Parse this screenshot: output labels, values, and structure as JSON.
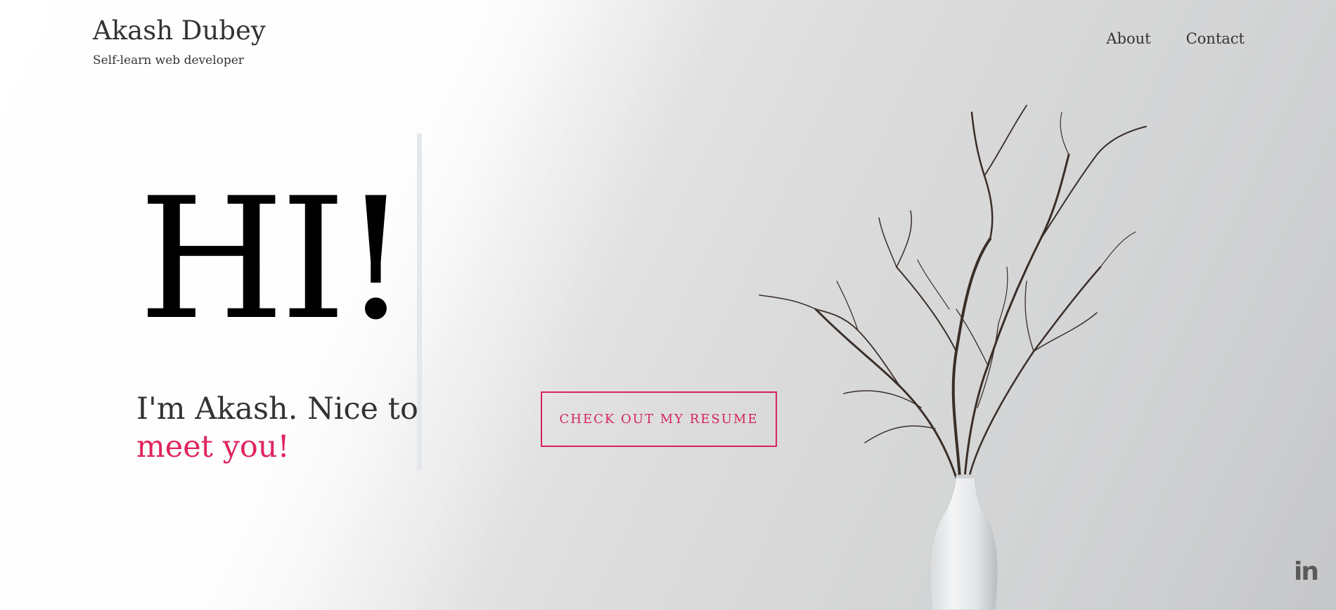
{
  "header": {
    "brand_name": "Akash Dubey",
    "tagline": "Self-learn web developer",
    "nav": [
      {
        "label": "About"
      },
      {
        "label": "Contact"
      }
    ]
  },
  "hero": {
    "greeting": "HI!",
    "intro_line1": "I'm Akash. Nice to",
    "intro_line2": "meet you!",
    "resume_button": "CHECK OUT MY RESUME"
  },
  "social": {
    "linkedin_text": "in",
    "linkedin_icon": "linkedin-icon"
  },
  "colors": {
    "accent": "#e0245e",
    "text": "#333333"
  }
}
